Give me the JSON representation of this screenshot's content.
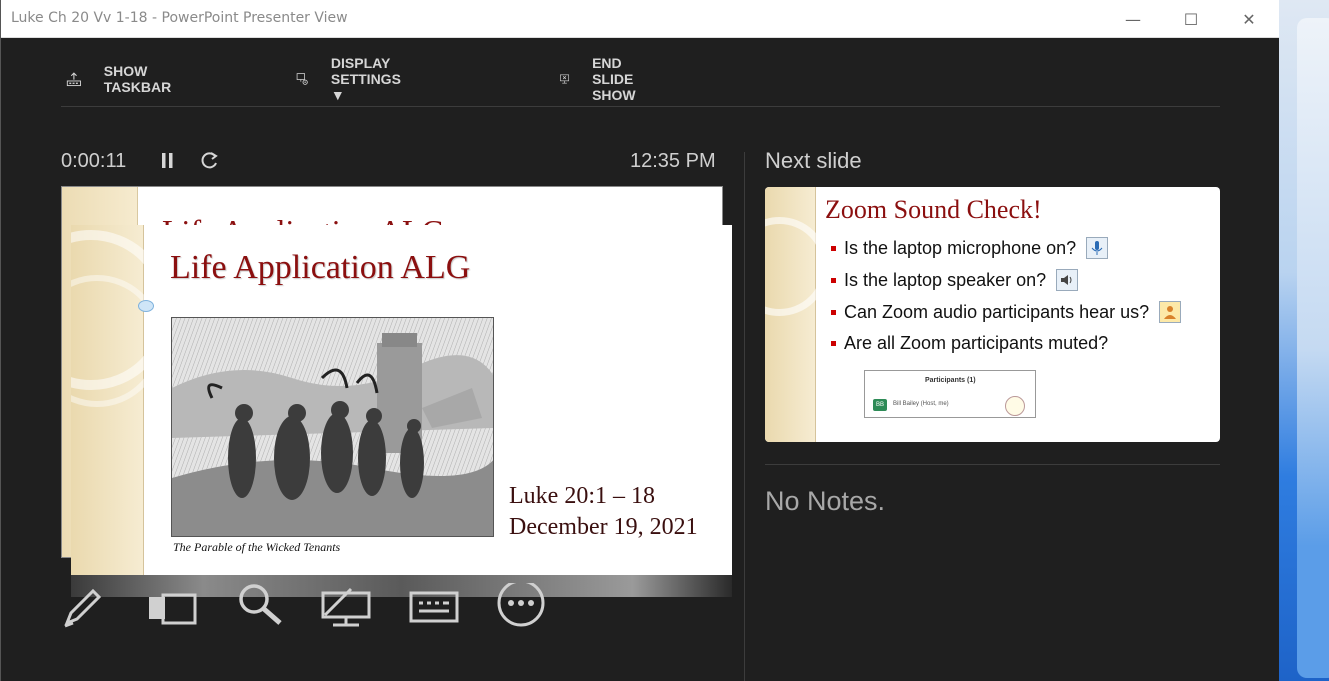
{
  "window": {
    "title": "Luke Ch 20 Vv 1-18 - PowerPoint Presenter View",
    "minimize_glyph": "—",
    "maximize_glyph": "☐",
    "close_glyph": "✕"
  },
  "toolbar": {
    "show_taskbar": "SHOW TASKBAR",
    "display_settings": "DISPLAY SETTINGS ▼",
    "end_slide_show": "END SLIDE SHOW"
  },
  "timer": {
    "elapsed": "0:00:11",
    "clock": "12:35 PM"
  },
  "current_slide": {
    "title": "Life Application ALG",
    "caption": "The Parable of the Wicked Tenants",
    "reference": "Luke 20:1 – 18",
    "date": "December 19, 2021"
  },
  "next_slide": {
    "label": "Next slide",
    "title": "Zoom Sound Check!",
    "bullets": [
      "Is the laptop microphone on?",
      "Is the laptop speaker on?",
      "Can Zoom audio participants hear us?",
      "Are all Zoom participants muted?"
    ],
    "participants_header": "Participants (1)",
    "participant_initials": "BB",
    "participant_name": "Bill Bailey (Host, me)"
  },
  "notes": {
    "text": "No Notes."
  },
  "icons": {
    "toolbar": [
      "show-taskbar-icon",
      "display-settings-icon",
      "end-slide-show-icon"
    ],
    "controls": [
      "pause-icon",
      "restart-icon"
    ],
    "tools": [
      "pen-icon",
      "all-slides-icon",
      "zoom-icon",
      "black-screen-icon",
      "subtitles-icon",
      "more-options-icon"
    ]
  },
  "colors": {
    "background": "#1f1f1f",
    "slide_title": "#8b0f0f",
    "text": "#cfcfcf"
  }
}
